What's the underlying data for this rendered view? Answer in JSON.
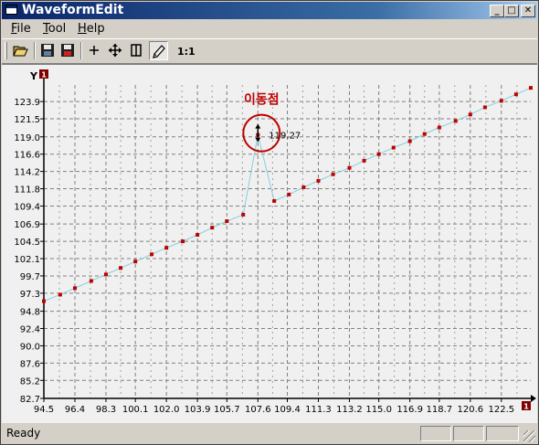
{
  "window": {
    "title": "WaveformEdit",
    "controls": {
      "minimize": "_",
      "maximize": "□",
      "close": "✕"
    }
  },
  "menu": [
    {
      "label": "File",
      "underline": "F",
      "rest": "ile"
    },
    {
      "label": "Tool",
      "underline": "T",
      "rest": "ool"
    },
    {
      "label": "Help",
      "underline": "H",
      "rest": "elp"
    }
  ],
  "toolbar": {
    "buttons": [
      {
        "name": "open-button",
        "icon": "folder-open-icon",
        "tooltip": ""
      },
      {
        "name": "save-button",
        "icon": "floppy-disk-icon"
      },
      {
        "name": "save-as-button",
        "icon": "floppy-disk-red-icon"
      },
      {
        "name": "crosshair-button",
        "icon": "plus-icon"
      },
      {
        "name": "pan-button",
        "icon": "move-arrows-icon"
      },
      {
        "name": "fit-button",
        "icon": "fit-width-icon"
      },
      {
        "name": "pencil-button",
        "icon": "pencil-icon",
        "pressed": true
      }
    ],
    "zoom_label": "1:1"
  },
  "chart_data": {
    "type": "line",
    "series": [
      {
        "x": [
          94.5,
          95.5,
          96.4,
          97.4,
          98.3,
          99.2,
          100.1,
          101.1,
          102.0,
          103.0,
          103.9,
          104.8,
          105.7,
          106.7,
          107.6,
          108.6,
          109.5,
          110.4,
          111.3,
          112.2,
          113.2,
          114.1,
          115.0,
          115.9,
          116.9,
          117.8,
          118.7,
          119.7,
          120.6,
          121.5,
          122.5,
          123.4,
          124.3
        ],
        "y": [
          96.2,
          97.1,
          98.0,
          99.0,
          99.9,
          100.8,
          101.7,
          102.7,
          103.6,
          104.5,
          105.4,
          106.4,
          107.3,
          108.2,
          119.27,
          110.1,
          111.0,
          112.0,
          112.9,
          113.8,
          114.7,
          115.7,
          116.6,
          117.5,
          118.4,
          119.4,
          120.3,
          121.2,
          122.1,
          123.1,
          124.0,
          124.9,
          125.8
        ]
      }
    ],
    "line_color": "#7fd0e0",
    "marker_color": "#c00000",
    "ylabel": "Y",
    "yticks": [
      "82.7",
      "85.2",
      "87.6",
      "90.0",
      "92.4",
      "94.8",
      "97.3",
      "99.7",
      "102.1",
      "104.5",
      "106.9",
      "109.4",
      "111.8",
      "114.2",
      "116.6",
      "119.0",
      "121.5",
      "123.9"
    ],
    "xticks": [
      "94.5",
      "96.4",
      "98.3",
      "100.1",
      "102.0",
      "103.9",
      "105.7",
      "107.6",
      "109.4",
      "111.3",
      "113.2",
      "115.0",
      "116.9",
      "118.7",
      "120.6",
      "122.5"
    ],
    "ylim": [
      82.7,
      126.2
    ],
    "xlim": [
      94.5,
      124.3
    ],
    "grid": true,
    "axis_badges": {
      "y": "1",
      "x": "1"
    },
    "annotation": {
      "label": "이동점",
      "value_text": "119.27",
      "point_index": 14,
      "color": "#c00000"
    }
  },
  "status": {
    "text": "Ready"
  }
}
